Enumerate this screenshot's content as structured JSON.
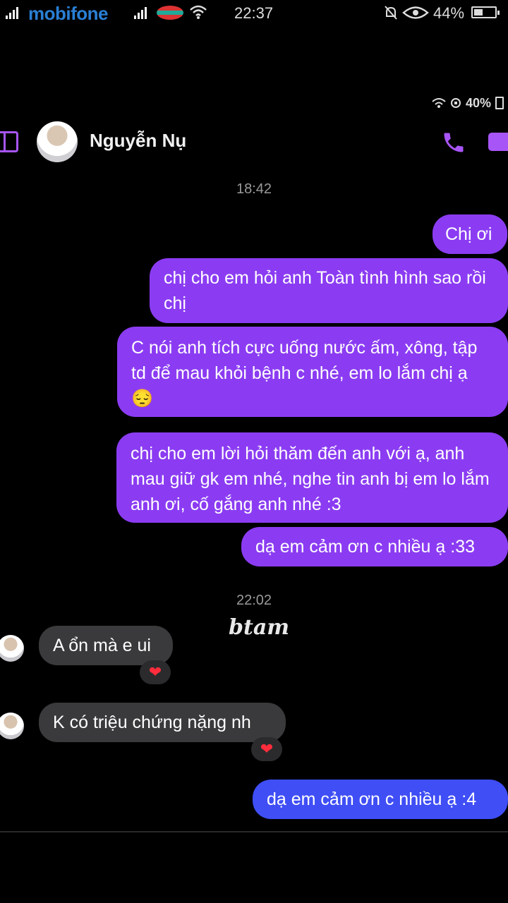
{
  "status_bar": {
    "carrier": "mobifone",
    "time": "22:37",
    "battery": "44%"
  },
  "inner_status": {
    "battery": "40%"
  },
  "header": {
    "contact_name": "Nguyễn Nụ",
    "accent": "#a855f7"
  },
  "timestamps": [
    "18:42",
    "22:02"
  ],
  "sent_messages": [
    "Chị ơi",
    "chị cho em hỏi anh Toàn tình hình sao rồi chị",
    "C nói anh tích cực uống nước ấm, xông, tập td để mau khỏi bệnh c nhé, em lo lắm chị ạ 😔",
    "chị cho em lời hỏi thăm đến anh với ạ, anh mau giữ gk em nhé, nghe tin anh bị em lo lắm anh ơi, cố gắng anh nhé :3",
    "dạ em cảm ơn c nhiều ạ :33",
    "dạ em cảm ơn c nhiều ạ :4"
  ],
  "received_messages": [
    "A ổn mà e ui",
    "K có triệu chứng nặng nh"
  ],
  "reactions": [
    "❤",
    "❤"
  ],
  "watermark": "btam",
  "colors": {
    "sent_bubble": "#8b3cf2",
    "last_sent_bubble": "#3f4ef5",
    "received_bubble": "#3a3a3c"
  }
}
